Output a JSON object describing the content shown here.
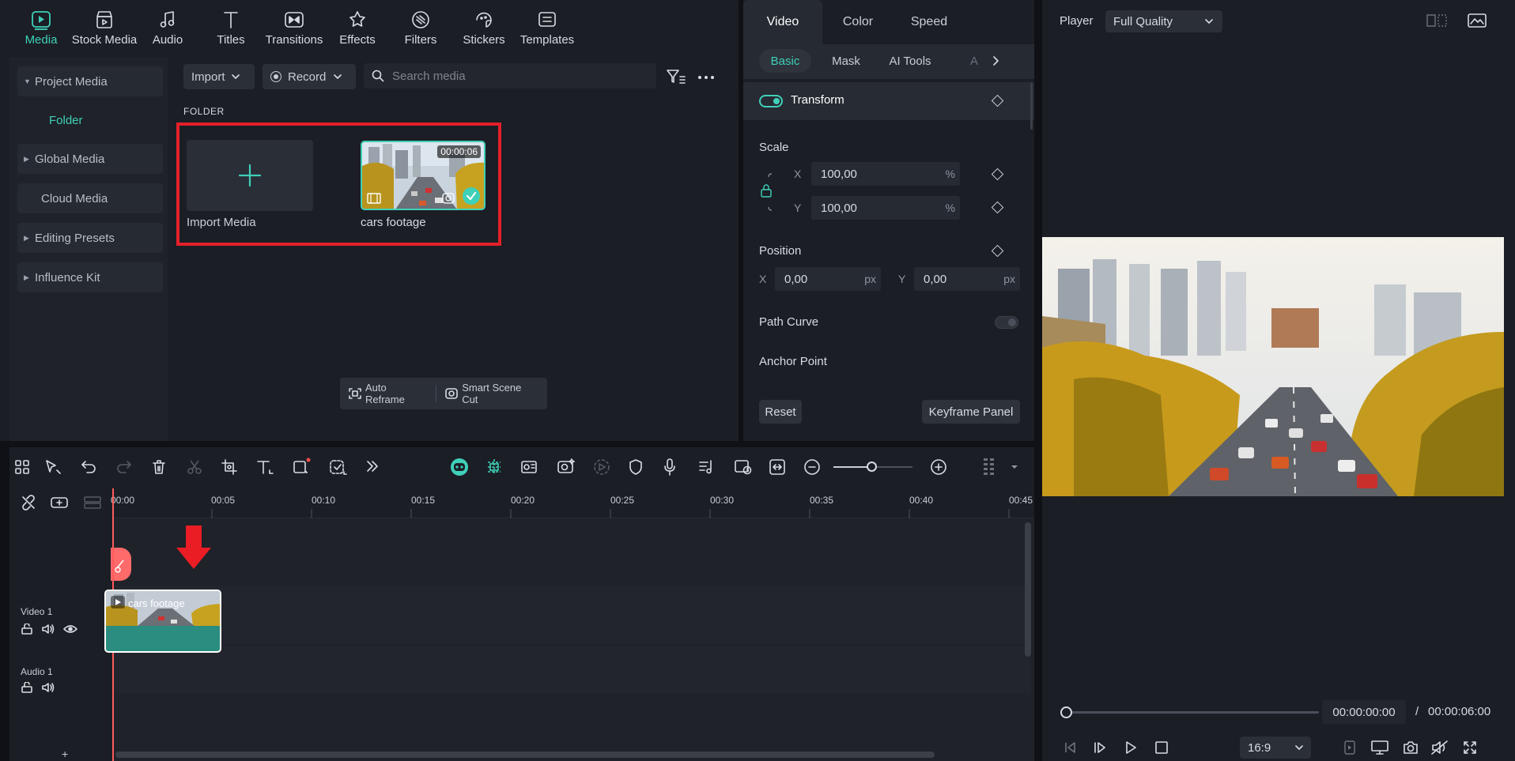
{
  "top_tabs": [
    {
      "label": "Media",
      "icon": "media-icon",
      "active": true
    },
    {
      "label": "Stock Media",
      "icon": "stock-media-icon"
    },
    {
      "label": "Audio",
      "icon": "audio-icon"
    },
    {
      "label": "Titles",
      "icon": "titles-icon"
    },
    {
      "label": "Transitions",
      "icon": "transitions-icon"
    },
    {
      "label": "Effects",
      "icon": "effects-icon"
    },
    {
      "label": "Filters",
      "icon": "filters-icon"
    },
    {
      "label": "Stickers",
      "icon": "stickers-icon"
    },
    {
      "label": "Templates",
      "icon": "templates-icon"
    }
  ],
  "sidebar": {
    "project_media": "Project Media",
    "folder": "Folder",
    "global_media": "Global Media",
    "cloud_media": "Cloud Media",
    "editing_presets": "Editing Presets",
    "influence_kit": "Influence Kit"
  },
  "toolbar": {
    "import_label": "Import",
    "record_label": "Record",
    "search_placeholder": "Search media"
  },
  "folder_heading": "FOLDER",
  "media_items": {
    "import_label": "Import Media",
    "clip_label": "cars footage",
    "clip_duration": "00:00:06"
  },
  "bottom_tools": {
    "auto_reframe": "Auto Reframe",
    "smart_scene_cut": "Smart Scene Cut"
  },
  "properties": {
    "tabs": [
      "Video",
      "Color",
      "Speed"
    ],
    "sub_tabs": [
      "Basic",
      "Mask",
      "AI Tools",
      "A"
    ],
    "transform_label": "Transform",
    "scale_label": "Scale",
    "scale_x_label": "X",
    "scale_x": "100,00",
    "scale_y_label": "Y",
    "scale_y": "100,00",
    "percent": "%",
    "position_label": "Position",
    "pos_x_label": "X",
    "pos_x": "0,00",
    "pos_y_label": "Y",
    "pos_y": "0,00",
    "px": "px",
    "path_curve": "Path Curve",
    "anchor_point": "Anchor Point",
    "reset": "Reset",
    "keyframe_panel": "Keyframe Panel"
  },
  "player": {
    "title": "Player",
    "quality": "Full Quality",
    "current_time": "00:00:00:00",
    "separator": "/",
    "total_time": "00:00:06:00",
    "ratio": "16:9"
  },
  "timeline": {
    "ticks": [
      "00:00",
      "00:05",
      "00:10",
      "00:15",
      "00:20",
      "00:25",
      "00:30",
      "00:35",
      "00:40",
      "00:45"
    ],
    "video_track": "Video 1",
    "audio_track": "Audio 1",
    "clip_label": "cars footage"
  },
  "colors": {
    "accent": "#3fd0b8",
    "highlight": "#e5202a",
    "playhead": "#ff5b5b"
  }
}
